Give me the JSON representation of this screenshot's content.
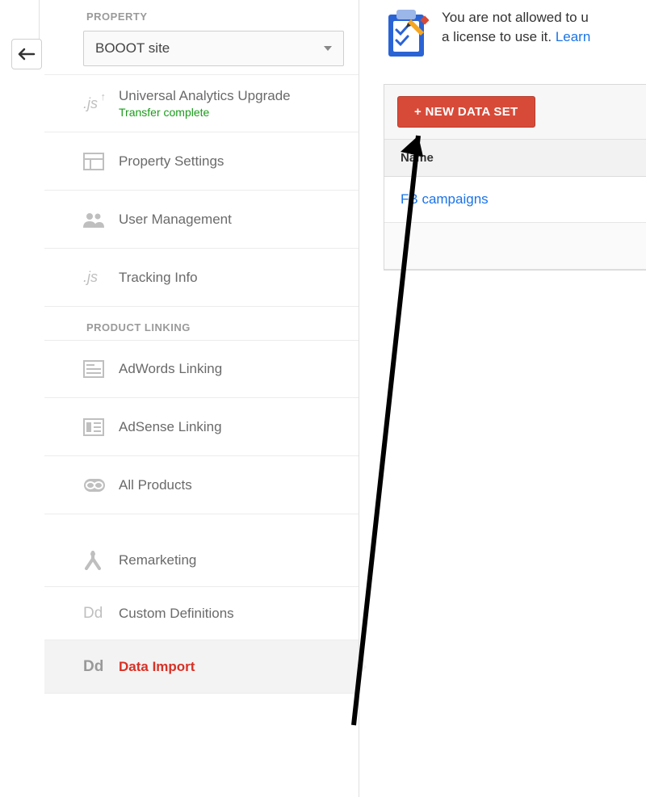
{
  "sidebar": {
    "back_aria": "Back",
    "section1_label": "PROPERTY",
    "property_selected": "BOOOT site",
    "items": [
      {
        "label": "Universal Analytics Upgrade",
        "sub": "Transfer complete"
      },
      {
        "label": "Property Settings"
      },
      {
        "label": "User Management"
      },
      {
        "label": "Tracking Info"
      }
    ],
    "section2_label": "PRODUCT LINKING",
    "items2": [
      {
        "label": "AdWords Linking"
      },
      {
        "label": "AdSense Linking"
      },
      {
        "label": "All Products"
      }
    ],
    "items3": [
      {
        "label": "Remarketing"
      },
      {
        "label": "Custom Definitions"
      },
      {
        "label": "Data Import"
      }
    ]
  },
  "main": {
    "notice_text": "You are not allowed to u",
    "notice_text2": "a license to use it. ",
    "notice_link": "Learn",
    "new_button": "+ NEW DATA SET",
    "col_name": "Name",
    "rows": [
      {
        "name": "FB campaigns"
      }
    ]
  },
  "colors": {
    "red_btn": "#d84a38",
    "active_red": "#d93025",
    "link_blue": "#1a73e8",
    "success_green": "#1a9b1a"
  }
}
